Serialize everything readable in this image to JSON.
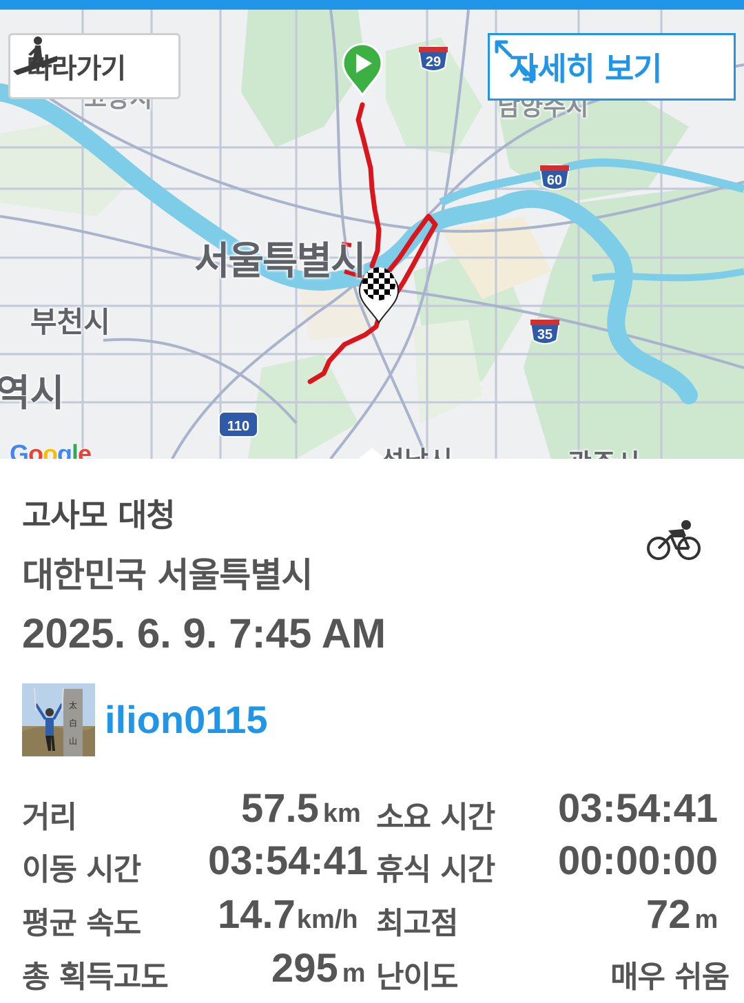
{
  "map": {
    "follow_label": "따라가기",
    "detail_label": "자세히 보기",
    "places": {
      "seoul": "서울특별시",
      "bucheon": "부천시",
      "incheon": "역시",
      "goyang": "고양시",
      "namyangju": "남양주시",
      "seongnam": "성남시",
      "gwangju": "광주시"
    },
    "highways": [
      "29",
      "60",
      "35",
      "110"
    ],
    "attribution": "Google"
  },
  "activity": {
    "title": "고사모 대청",
    "location": "대한민국 서울특별시",
    "datetime": "2025. 6. 9. 7:45 AM",
    "type_icon": "cycling-icon"
  },
  "user": {
    "name": "ilion0115"
  },
  "stats": {
    "distance": {
      "label": "거리",
      "value": "57.5",
      "unit": "km"
    },
    "elapsed": {
      "label": "소요 시간",
      "value": "03:54:41"
    },
    "moving": {
      "label": "이동 시간",
      "value": "03:54:41"
    },
    "rest": {
      "label": "휴식 시간",
      "value": "00:00:00"
    },
    "avg_speed": {
      "label": "평균 속도",
      "value": "14.7",
      "unit": "km/h"
    },
    "max_elev": {
      "label": "최고점",
      "value": "72",
      "unit": "m"
    },
    "gain": {
      "label": "총 획득고도",
      "value": "295",
      "unit": "m"
    },
    "difficulty": {
      "label": "난이도",
      "value": "매우 쉬움"
    }
  },
  "colors": {
    "accent": "#2196e8",
    "route": "#d9161c",
    "start_marker": "#3cb043",
    "text": "#555555"
  }
}
